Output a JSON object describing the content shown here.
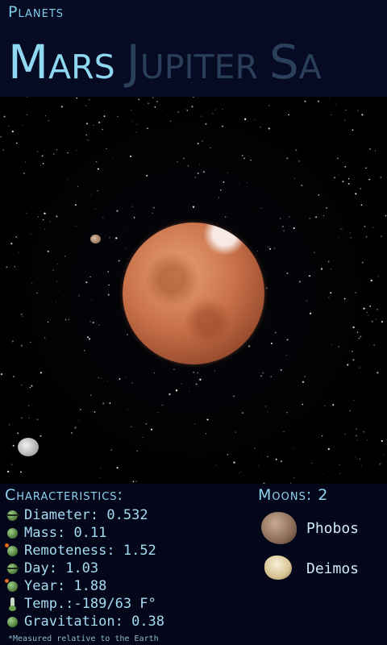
{
  "app_title": "Planets",
  "pager": {
    "active": "Mars",
    "next_1": "Jupiter",
    "next_2": "Sa"
  },
  "characteristics": {
    "title": "Characteristics:",
    "items": [
      {
        "label": "Diameter:",
        "value": "0.532",
        "icon": "diameter-icon"
      },
      {
        "label": "Mass:",
        "value": "0.11",
        "icon": "mass-icon"
      },
      {
        "label": "Remoteness:",
        "value": "1.52",
        "icon": "remoteness-icon"
      },
      {
        "label": "Day:",
        "value": "1.03",
        "icon": "day-icon"
      },
      {
        "label": "Year:",
        "value": "1.88",
        "icon": "year-icon"
      },
      {
        "label": "Temp.:",
        "value": "-189/63 F°",
        "icon": "thermometer-icon"
      },
      {
        "label": "Gravitation:",
        "value": "0.38",
        "icon": "gravitation-icon"
      }
    ],
    "footnote": "*Measured relative to the Earth"
  },
  "moons": {
    "title": "Moons:",
    "count": "2",
    "items": [
      {
        "name": "Phobos"
      },
      {
        "name": "Deimos"
      }
    ]
  }
}
